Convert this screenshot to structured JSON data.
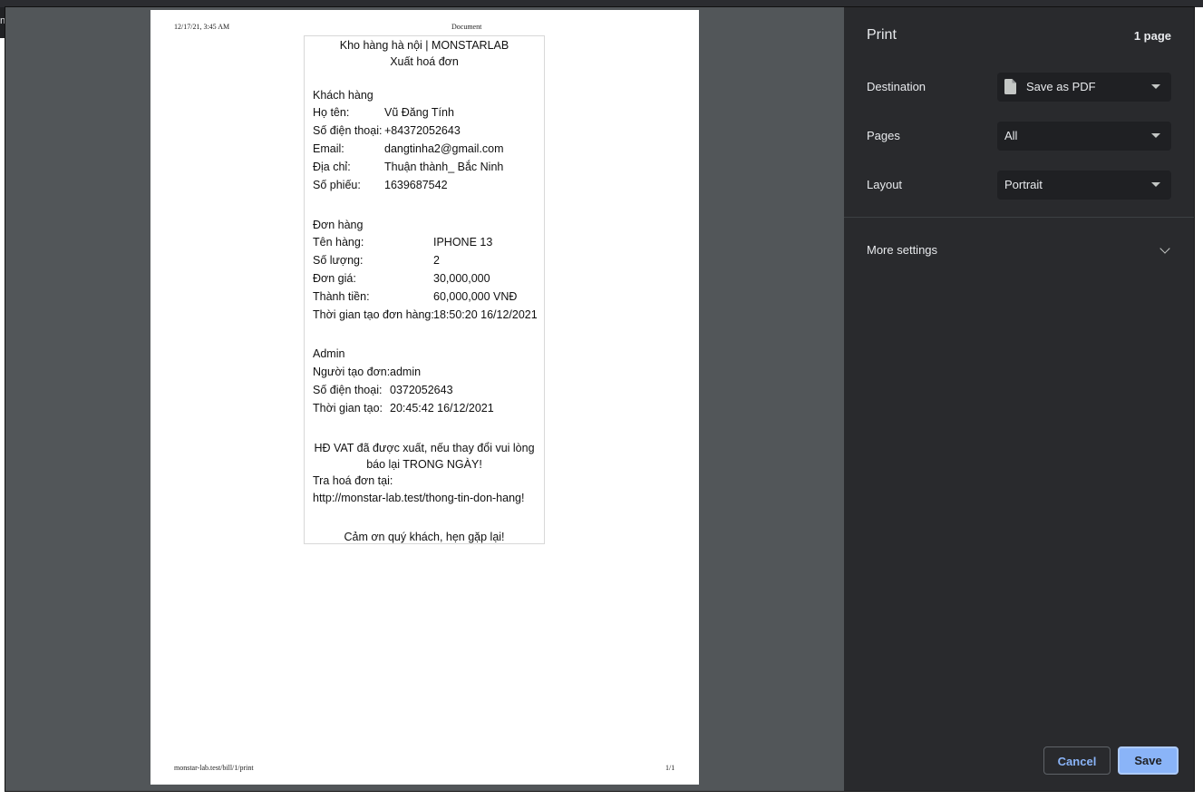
{
  "background_window": {
    "edge_glyph": "n"
  },
  "page_header": {
    "datetime": "12/17/21, 3:45 AM",
    "title": "Document"
  },
  "page_footer": {
    "url": "monstar-lab.test/bill/1/print",
    "page_number": "1/1"
  },
  "receipt": {
    "store": "Kho hàng hà nội | MONSTARLAB",
    "heading": "Xuất hoá đơn",
    "customer": {
      "section": "Khách hàng",
      "rows": [
        {
          "label": "Họ tên:",
          "value": "Vũ Đăng Tính"
        },
        {
          "label": "Số điện thoại:",
          "value": "+84372052643"
        },
        {
          "label": "Email:",
          "value": "dangtinha2@gmail.com"
        },
        {
          "label": "Địa chỉ:",
          "value": "Thuận thành_ Bắc Ninh"
        },
        {
          "label": "Số phiếu:",
          "value": "1639687542"
        }
      ]
    },
    "order": {
      "section": "Đơn hàng",
      "rows": [
        {
          "label": "Tên hàng:",
          "value": "IPHONE 13"
        },
        {
          "label": "Số lượng:",
          "value": "2"
        },
        {
          "label": "Đơn giá:",
          "value": "30,000,000"
        },
        {
          "label": "Thành tiền:",
          "value": "60,000,000 VNĐ"
        },
        {
          "label": "Thời gian tạo đơn hàng:",
          "value": "18:50:20 16/12/2021"
        }
      ]
    },
    "admin": {
      "section": "Admin",
      "rows": [
        {
          "label": "Người tạo đơn:",
          "value": "admin"
        },
        {
          "label": "Số điện thoại:",
          "value": "0372052643"
        },
        {
          "label": "Thời gian tạo:",
          "value": "20:45:42 16/12/2021"
        }
      ]
    },
    "notice_line1": "HĐ VAT đã được xuất, nếu thay đổi vui lòng",
    "notice_line2": "báo lại TRONG NGÀY!",
    "lookup_label": "Tra hoá đơn tại:",
    "lookup_url": "http://monstar-lab.test/thong-tin-don-hang!",
    "thanks": "Cảm ơn quý khách, hẹn gặp lại!"
  },
  "print_panel": {
    "title": "Print",
    "page_count": "1 page",
    "destination": {
      "label": "Destination",
      "value": "Save as PDF",
      "icon": "document-icon"
    },
    "pages": {
      "label": "Pages",
      "value": "All"
    },
    "layout": {
      "label": "Layout",
      "value": "Portrait"
    },
    "more_settings": "More settings",
    "cancel_label": "Cancel",
    "save_label": "Save"
  },
  "colors": {
    "panel_bg": "#292a2d",
    "preview_bg": "#525659",
    "accent": "#8ab4f8"
  }
}
